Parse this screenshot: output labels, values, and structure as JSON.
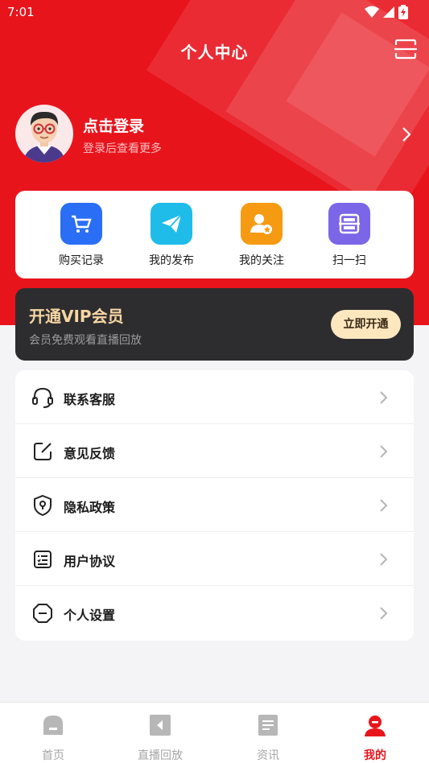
{
  "status_bar": {
    "time": "7:01"
  },
  "header": {
    "title": "个人中心",
    "scan_icon": "scan-icon"
  },
  "profile": {
    "login_title": "点击登录",
    "login_subtitle": "登录后查看更多"
  },
  "quick_actions": [
    {
      "label": "购买记录",
      "icon": "cart-icon",
      "color": "#2a6ef5"
    },
    {
      "label": "我的发布",
      "icon": "send-icon",
      "color": "#1fbcea"
    },
    {
      "label": "我的关注",
      "icon": "follow-user-icon",
      "color": "#f69a12"
    },
    {
      "label": "扫一扫",
      "icon": "scan-icon",
      "color": "#7b66e8"
    }
  ],
  "vip": {
    "title": "开通VIP会员",
    "subtitle": "会员免费观看直播回放",
    "button": "立即开通"
  },
  "menu": [
    {
      "label": "联系客服",
      "icon": "headset-icon"
    },
    {
      "label": "意见反馈",
      "icon": "feedback-edit-icon"
    },
    {
      "label": "隐私政策",
      "icon": "privacy-shield-icon"
    },
    {
      "label": "用户协议",
      "icon": "agreement-list-icon"
    },
    {
      "label": "个人设置",
      "icon": "settings-hexagon-icon"
    }
  ],
  "bottom_nav": [
    {
      "label": "首页",
      "icon": "home-icon",
      "active": false
    },
    {
      "label": "直播回放",
      "icon": "playback-icon",
      "active": false
    },
    {
      "label": "资讯",
      "icon": "news-icon",
      "active": false
    },
    {
      "label": "我的",
      "icon": "profile-icon",
      "active": true
    }
  ],
  "colors": {
    "brand_red": "#e8141c",
    "vip_gold": "#f7d6a4",
    "inactive_gray": "#a6a6a6"
  }
}
